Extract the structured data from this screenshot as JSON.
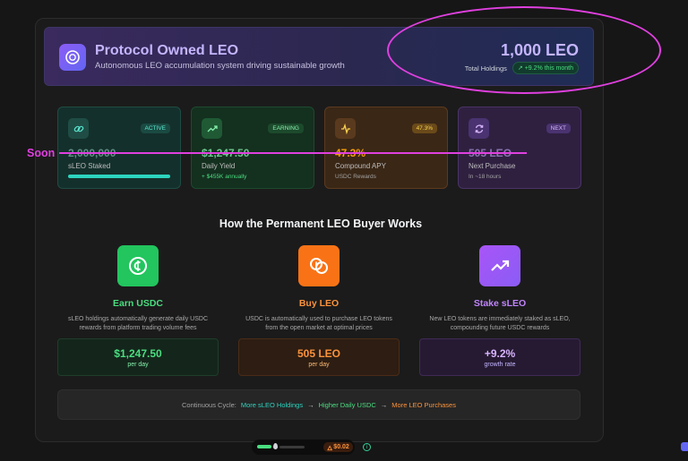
{
  "hero": {
    "title": "Protocol Owned LEO",
    "subtitle": "Autonomous LEO accumulation system driving sustainable growth",
    "amount": "1,000 LEO",
    "holdings_label": "Total Holdings",
    "growth_badge": "↗ +9.2% this month",
    "icon": "coin-icon"
  },
  "annotation": {
    "soon_label": "Soon",
    "color": "#e040e0"
  },
  "stats": [
    {
      "icon": "link-icon",
      "tag": "ACTIVE",
      "value": "2,000,000",
      "label": "sLEO Staked",
      "progress": 1.0
    },
    {
      "icon": "trending-up-icon",
      "tag": "EARNING",
      "value": "$1,247.50",
      "label": "Daily Yield",
      "sub": "+ $455K annually"
    },
    {
      "icon": "activity-icon",
      "tag": "47.3%",
      "value": "47.3%",
      "label": "Compound APY",
      "sub": "USDC Rewards"
    },
    {
      "icon": "refresh-icon",
      "tag": "NEXT",
      "value": "505 LEO",
      "label": "Next Purchase",
      "sub": "In ~18 hours"
    }
  ],
  "section_title": "How the Permanent LEO Buyer Works",
  "steps": [
    {
      "icon": "usdc-icon",
      "title": "Earn USDC",
      "desc1": "sLEO holdings automatically generate daily USDC",
      "desc2": "rewards from platform trading volume fees",
      "value": "$1,247.50",
      "unit": "per day",
      "color": "#4ade80"
    },
    {
      "icon": "coins-icon",
      "title": "Buy LEO",
      "desc1": "USDC is automatically used to purchase LEO tokens",
      "desc2": "from the open market at optimal prices",
      "value": "505 LEO",
      "unit": "per day",
      "color": "#fb923c"
    },
    {
      "icon": "trending-up-icon",
      "title": "Stake sLEO",
      "desc1": "New LEO tokens are immediately staked as sLEO,",
      "desc2": "compounding future USDC rewards",
      "value": "+9.2%",
      "unit": "growth rate",
      "color": "#c084fc"
    }
  ],
  "cycle": {
    "prefix": "Continuous Cycle:",
    "item1": "More sLEO Holdings",
    "arrow1": "→",
    "item2": "Higher Daily USDC",
    "arrow2": "→",
    "item3": "More LEO Purchases"
  },
  "bottom_bar": {
    "price": "$0.02",
    "price_icon": "fire-icon",
    "info_icon": "info-icon"
  }
}
